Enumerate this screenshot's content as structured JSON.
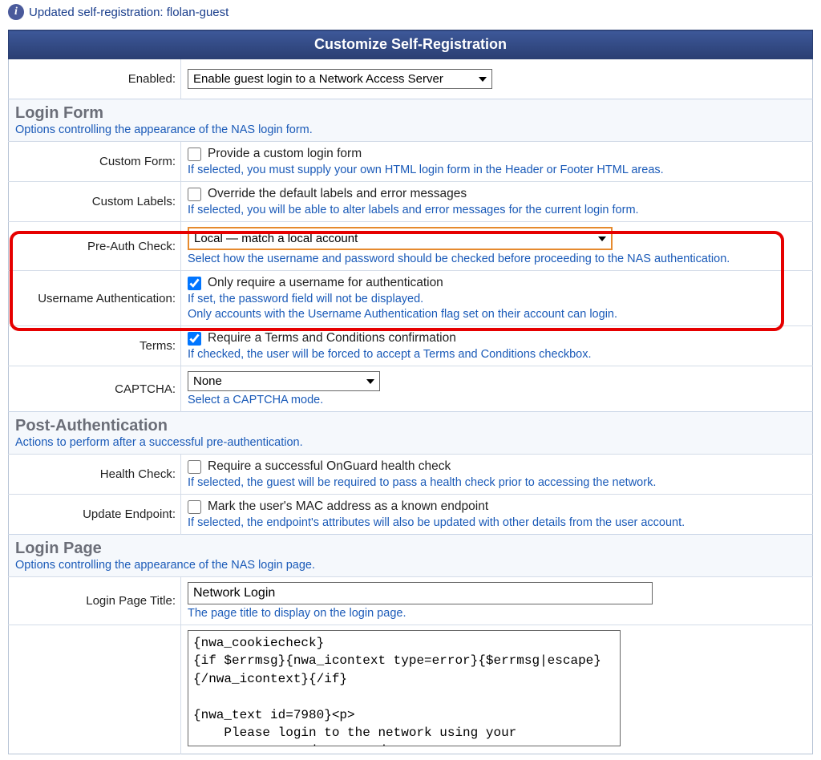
{
  "status": "Updated self-registration: flolan-guest",
  "panel_title": "Customize Self-Registration",
  "enabled": {
    "label": "Enabled:",
    "value": "Enable guest login to a Network Access Server"
  },
  "login_form": {
    "heading": "Login Form",
    "desc": "Options controlling the appearance of the NAS login form.",
    "custom_form": {
      "label": "Custom Form:",
      "cb_label": "Provide a custom login form",
      "help": "If selected, you must supply your own HTML login form in the Header or Footer HTML areas."
    },
    "custom_labels": {
      "label": "Custom Labels:",
      "cb_label": "Override the default labels and error messages",
      "help": "If selected, you will be able to alter labels and error messages for the current login form."
    },
    "preauth": {
      "label": "Pre-Auth Check:",
      "value": "Local — match a local account",
      "help": "Select how the username and password should be checked before proceeding to the NAS authentication."
    },
    "username_auth": {
      "label": "Username Authentication:",
      "cb_label": "Only require a username for authentication",
      "help1": "If set, the password field will not be displayed.",
      "help2": "Only accounts with the Username Authentication flag set on their account can login."
    },
    "terms": {
      "label": "Terms:",
      "cb_label": "Require a Terms and Conditions confirmation",
      "help": "If checked, the user will be forced to accept a Terms and Conditions checkbox."
    },
    "captcha": {
      "label": "CAPTCHA:",
      "value": "None",
      "help": "Select a CAPTCHA mode."
    }
  },
  "post_auth": {
    "heading": "Post-Authentication",
    "desc": "Actions to perform after a successful pre-authentication.",
    "health": {
      "label": "Health Check:",
      "cb_label": "Require a successful OnGuard health check",
      "help": "If selected, the guest will be required to pass a health check prior to accessing the network."
    },
    "endpoint": {
      "label": "Update Endpoint:",
      "cb_label": "Mark the user's MAC address as a known endpoint",
      "help": "If selected, the endpoint's attributes will also be updated with other details from the user account."
    }
  },
  "login_page": {
    "heading": "Login Page",
    "desc": "Options controlling the appearance of the NAS login page.",
    "title_field": {
      "label": "Login Page Title:",
      "value": "Network Login",
      "help": "The page title to display on the login page."
    },
    "body_field": "{nwa_cookiecheck}\n{if $errmsg}{nwa_icontext type=error}{$errmsg|escape}\n{/nwa_icontext}{/if}\n\n{nwa_text id=7980}<p>\n    Please login to the network using your\n    username and password."
  }
}
